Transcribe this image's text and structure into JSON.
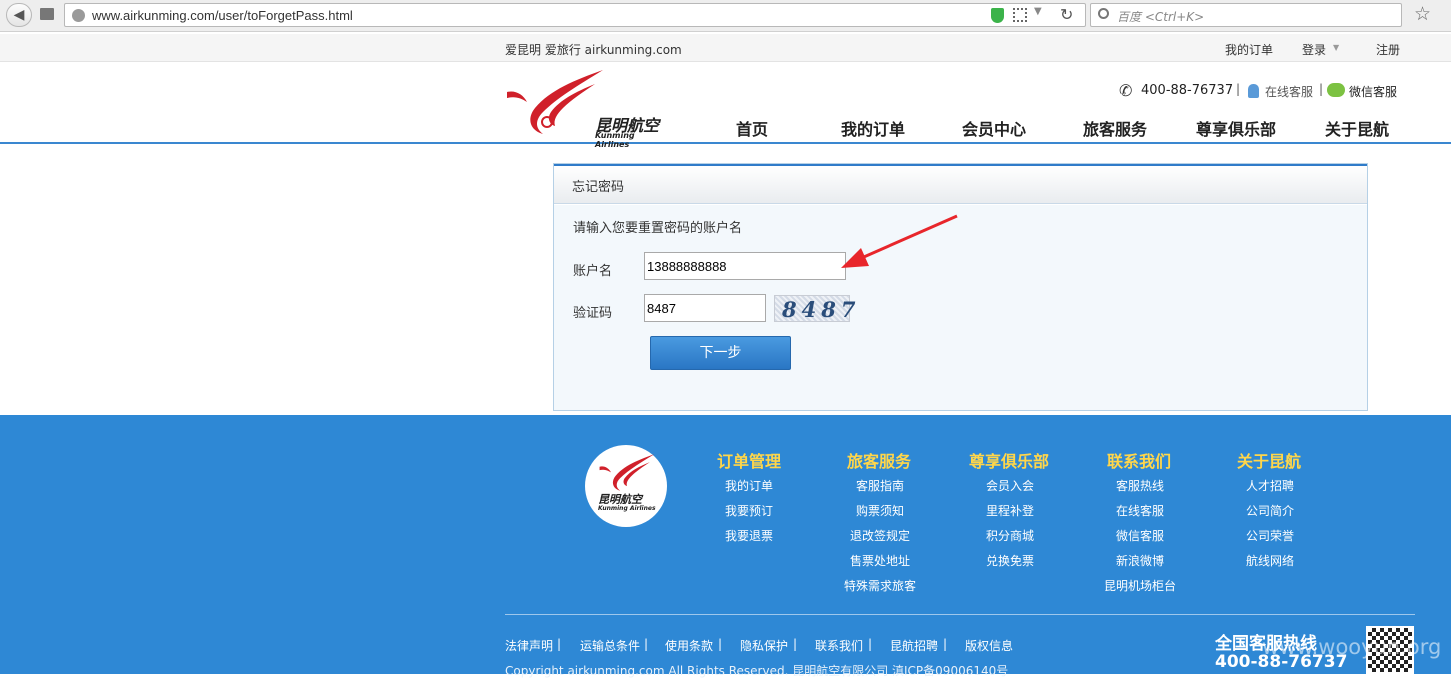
{
  "browser": {
    "url": "www.airkunming.com/user/toForgetPass.html",
    "search_placeholder": "百度 <Ctrl+K>"
  },
  "topbar": {
    "tagline": "爱昆明 爱旅行 airkunming.com",
    "my_orders": "我的订单",
    "login": "登录",
    "register": "注册"
  },
  "header": {
    "logo_cn": "昆明航空",
    "logo_en": "Kunming Airlines",
    "phone": "400-88-76737",
    "online_service": "在线客服",
    "wechat_service": "微信客服",
    "menu": [
      "首页",
      "我的订单",
      "会员中心",
      "旅客服务",
      "尊享俱乐部",
      "关于昆航"
    ]
  },
  "form": {
    "title": "忘记密码",
    "instruction": "请输入您要重置密码的账户名",
    "account_label": "账户名",
    "account_value": "13888888888",
    "captcha_label": "验证码",
    "captcha_value": "8487",
    "captcha_image_text": "8487",
    "next_button": "下一步"
  },
  "footer": {
    "logo_cn": "昆明航空",
    "logo_en": "Kunming Airlines",
    "columns": [
      {
        "title": "订单管理",
        "links": [
          "我的订单",
          "我要预订",
          "我要退票"
        ]
      },
      {
        "title": "旅客服务",
        "links": [
          "客服指南",
          "购票须知",
          "退改签规定",
          "售票处地址",
          "特殊需求旅客"
        ]
      },
      {
        "title": "尊享俱乐部",
        "links": [
          "会员入会",
          "里程补登",
          "积分商城",
          "兑换免票"
        ]
      },
      {
        "title": "联系我们",
        "links": [
          "客服热线",
          "在线客服",
          "微信客服",
          "新浪微博",
          "昆明机场柜台"
        ]
      },
      {
        "title": "关于昆航",
        "links": [
          "人才招聘",
          "公司简介",
          "公司荣誉",
          "航线网络"
        ]
      }
    ],
    "bottom_links": [
      "法律声明",
      "运输总条件",
      "使用条款",
      "隐私保护",
      "联系我们",
      "昆航招聘",
      "版权信息"
    ],
    "copyright": "Copyright airkunming.com All Rights Reserved. 昆明航空有限公司 滇ICP备09006140号",
    "hotline_label": "全国客服热线",
    "hotline_number": "400-88-76737",
    "watermark": "www.wooyun.org"
  },
  "colors": {
    "accent_blue": "#2e88d5",
    "footer_heading": "#ffd64a",
    "logo_red": "#d0202a",
    "annotation_red": "#e8262b"
  }
}
